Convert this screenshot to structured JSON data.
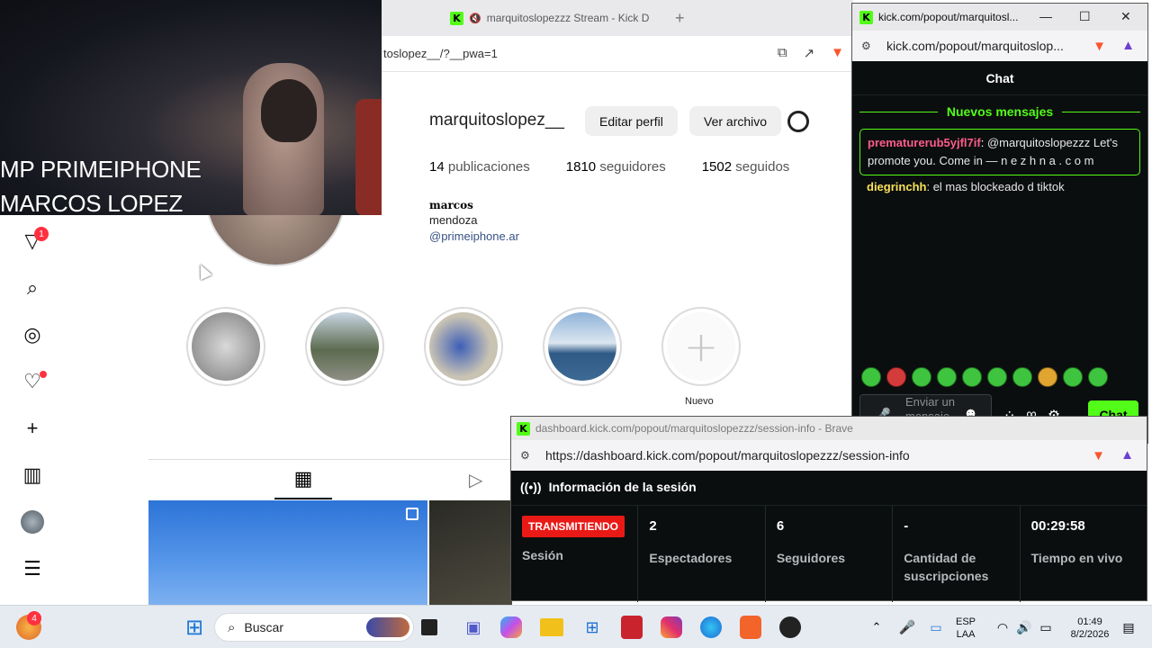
{
  "browser_bg": {
    "tab_title": "marquitoslopezzz Stream - Kick D",
    "url": "toslopez__/?__pwa=1"
  },
  "webcam": {
    "line1": "MP PRIMEIPHONE",
    "line2": "MARCOS LOPEZ"
  },
  "instagram": {
    "username": "marquitoslopez__",
    "edit_profile": "Editar perfil",
    "view_archive": "Ver archivo",
    "stats": [
      {
        "value": "14",
        "label": "publicaciones"
      },
      {
        "value": "1810",
        "label": "seguidores"
      },
      {
        "value": "1502",
        "label": "seguidos"
      }
    ],
    "display_name": "marcos",
    "city": "mendoza",
    "link": "@primeiphone.ar",
    "highlight_new_label": "Nuevo",
    "notif_count": "1"
  },
  "chat_window": {
    "title": "kick.com/popout/marquitosl...",
    "url": "kick.com/popout/marquitoslop...",
    "header": "Chat",
    "new_messages": "Nuevos mensajes",
    "messages": [
      {
        "user": "prematurerub5yjfl7if",
        "text": "@marquitoslopezzz Let's promote you. Come in — n e z h n a . c o m"
      },
      {
        "user": "diegrinchh",
        "text": "el mas blockeado d tiktok"
      }
    ],
    "input_placeholder": "Enviar un mensaje",
    "send_label": "Chat"
  },
  "session_window": {
    "title": "dashboard.kick.com/popout/marquitoslopezzz/session-info - Brave",
    "url": "https://dashboard.kick.com/popout/marquitoslopezzz/session-info",
    "header": "Información de la sesión",
    "live_badge": "TRANSMITIENDO",
    "stats": [
      {
        "value": "",
        "label": "Sesión"
      },
      {
        "value": "2",
        "label": "Espectadores"
      },
      {
        "value": "6",
        "label": "Seguidores"
      },
      {
        "value": "-",
        "label": "Cantidad de suscripciones"
      },
      {
        "value": "00:29:58",
        "label": "Tiempo en vivo"
      }
    ]
  },
  "taskbar": {
    "search_placeholder": "Buscar",
    "badge_count": "4",
    "lang_line1": "ESP",
    "lang_line2": "LAA",
    "time": "01:49",
    "date": "8/2/2026"
  }
}
